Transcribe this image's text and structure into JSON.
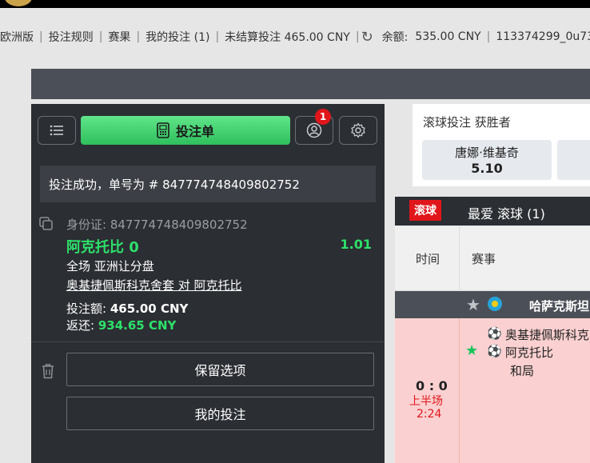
{
  "nav": {
    "items": [
      "欧洲版",
      "投注规则",
      "赛果",
      "我的投注 (1)",
      "未结算投注 465.00 CNY"
    ],
    "balance_label": "余额:",
    "balance_value": "535.00 CNY",
    "user": "113374299_0u73"
  },
  "betslip": {
    "title": "投注单",
    "notification_count": "1",
    "success_message": "投注成功，单号为 # 847774748409802752",
    "id_label": "身份证:",
    "id_value": "847774748409802752",
    "selection": "阿克托比 0",
    "odds": "1.01",
    "market": "全场 亚洲让分盘",
    "match": "奥基捷佩斯科克舍套 对 阿克托比",
    "stake_label": "投注额:",
    "stake_value": "465.00 CNY",
    "return_label": "返还:",
    "return_value": "934.65 CNY",
    "keep_button": "保留选项",
    "my_bets_button": "我的投注"
  },
  "winner_card": {
    "title": "滚球投注 获胜者",
    "selection_name": "唐娜·维基奇",
    "selection_odds": "5.10"
  },
  "live": {
    "tag": "滚球",
    "title": "最爱 滚球 (1)",
    "col_time": "时间",
    "col_event": "赛事",
    "league": "哈萨克斯坦",
    "event": {
      "score": "0 : 0",
      "period": "上半场",
      "clock": "2:24",
      "home": "奥基捷佩斯科克",
      "away": "阿克托比",
      "draw": "和局"
    }
  },
  "colors": {
    "accent_green": "#2ee06a",
    "live_red": "#e0161b",
    "panel_dark": "#2b2e33"
  }
}
